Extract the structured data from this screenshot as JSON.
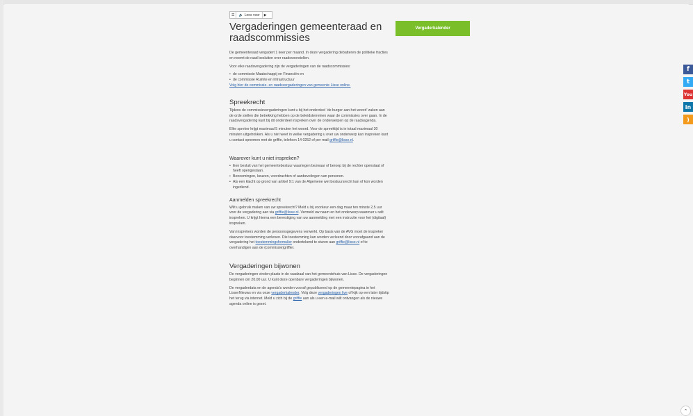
{
  "readspeaker": {
    "menu_icon": "☰",
    "speaker_icon": "🔈",
    "label": "Lees voor",
    "play_icon": "▶"
  },
  "page_title": "Vergaderingen gemeenteraad en raadscommissies",
  "calendar_button": "Vergaderkalender",
  "intro": {
    "p1": "De gemeenteraad vergadert 1 keer per maand. In deze vergadering debatteren de politieke fracties en neemt de raad besluiten over raadsvoorstellen.",
    "p2": "Voor elke raadsvergadering zijn de vergaderingen van de raadscommissies:",
    "items": [
      "de commissie Maatschappij en Financiën en",
      "de commissie Ruimte en Infrastructuur"
    ],
    "link": "Volg hier de commissie- en raadsvergaderingen van gemeente Lisse online."
  },
  "spreekrecht": {
    "heading": "Spreekrecht",
    "p1": "Tijdens de commissievergaderingen kunt u bij het onderdeel ‘de burger aan het woord’ zaken aan de orde stellen die betrekking hebben op de beleidsterreinen waar de commissies over gaan. In de raadsvergadering kunt bij dit onderdeel inspreken over de onderwerpen op de raadsagenda.",
    "p2_a": "Elke spreker krijgt maximaal 5 minuten het woord. Voor de spreektijd is in totaal maximaal 30 minuten uitgetrokken. Als u niet weet in welke vergadering u over uw onderwerp kan inspreken kunt u contact opnemen met de griffie, telefoon 14 0252 of per mail",
    "p2_link": "griffie@lisse.nl",
    "p2_b": "."
  },
  "waarover": {
    "heading": "Waarover kunt u niet inspreken?",
    "items": [
      "Een besluit van het gemeentebestuur waartegen bezwaar of beroep bij de rechter openstaat of heeft opengestaan.",
      "Benoemingen, keuzen, voordrachten of aanbevelingen van personen.",
      "Als een klacht op grond van artikel 9:1 van de Algemene wet bestuursrecht kan of kon worden ingediend."
    ]
  },
  "aanmelden": {
    "heading": "Aanmelden spreekrecht",
    "p1_a": "Wilt u gebruik maken van uw spreekrecht? Meld u bij voorkeur een dag maar ten minste 2,5 uur voor de vergadering aan via",
    "p1_link": "griffie@lisse.nl",
    "p1_b": ". Vermeld uw naam en het onderwerp waarover u wilt inspreken. U krijgt hierna een bevestiging van uw aanmelding met een instructie voor het (digitaal) inspreken.",
    "p2_a": "Van insprekers worden de persoonsgegevens verwerkt. Op basis van de AVG moet de inspreker daarvoor toestemming verlenen. Die toestemming kan worden verleend door voorafgaand aan de vergadering het",
    "p2_link1": "toestemmingsformulier",
    "p2_b": " ondertekend te sturen aan",
    "p2_link2": "griffie@lisse.nl",
    "p2_c": " of te overhandigen aan de (commissie)griffier."
  },
  "bijwonen": {
    "heading": "Vergaderingen bijwonen",
    "p1": "De vergaderingen vinden plaats in de raadzaal van het gemeentehuis van Lisse. De vergaderingen beginnen om 20.00 uur. U kunt deze openbare vergaderingen bijwonen.",
    "p2_a": "De vergaderdata en de agenda's worden vooraf gepubliceerd op de gemeentepagina in het LisserNieuws en via onze",
    "p2_link1": "vergaderkalender",
    "p2_b": ". Volg deze",
    "p2_link2": "vergaderingen live",
    "p2_c": " of kijk op een later tijdstip het terug via internet. Meld u zich bij de",
    "p2_link3": "griffie",
    "p2_d": " aan als u een e-mail wilt ontvangen als de nieuwe agenda online is gezet."
  },
  "social": {
    "facebook": "f",
    "twitter": "t",
    "youtube": "You",
    "linkedin": "in",
    "rss": ")"
  },
  "back_to_top": "⌃"
}
